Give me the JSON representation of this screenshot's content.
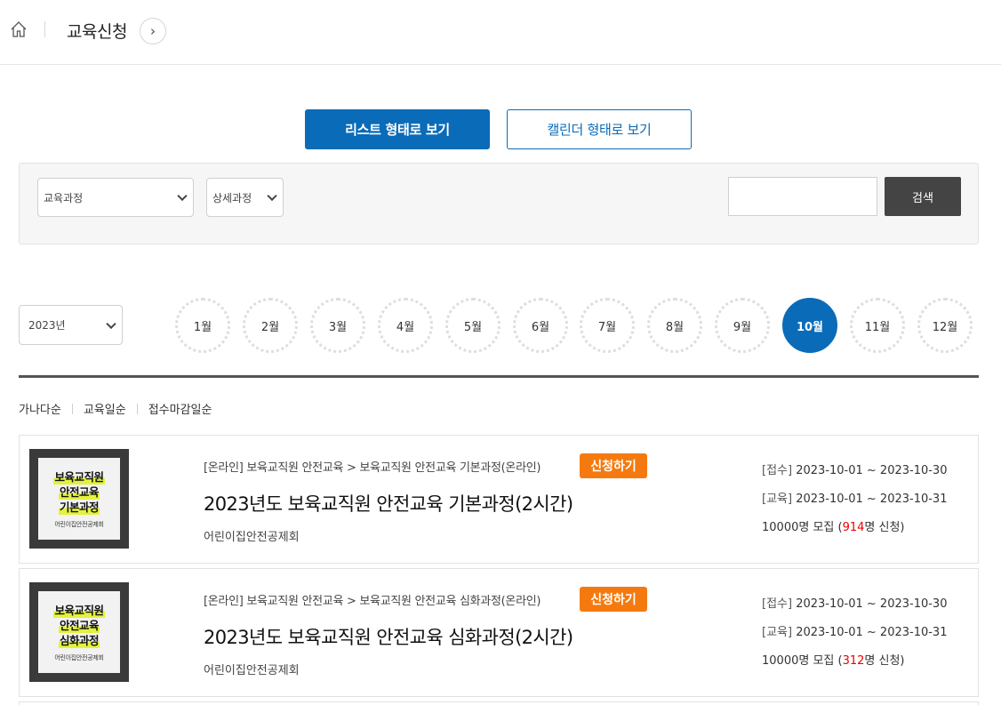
{
  "breadcrumb": {
    "title": "교육신청",
    "next_symbol": "›"
  },
  "view_toggle": {
    "list_label": "리스트 형태로 보기",
    "calendar_label": "캘린더 형태로 보기"
  },
  "filter": {
    "course_select": "교육과정",
    "detail_select": "상세과정",
    "search_value": "",
    "search_button": "검색"
  },
  "year_select": "2023년",
  "months": [
    "1월",
    "2월",
    "3월",
    "4월",
    "5월",
    "6월",
    "7월",
    "8월",
    "9월",
    "10월",
    "11월",
    "12월"
  ],
  "active_month": "10월",
  "sort": [
    "가나다순",
    "교육일순",
    "접수마감일순"
  ],
  "courses": [
    {
      "thumb_lines": [
        "보육교직원",
        "안전교육",
        "기본과정"
      ],
      "thumb_org": "어린이집안전공제회",
      "category": "[온라인] 보육교직원 안전교육 > 보육교직원 안전교육 기본과정(온라인)",
      "apply_label": "신청하기",
      "title": "2023년도 보육교직원 안전교육 기본과정(2시간)",
      "org": "어린이집안전공제회",
      "reg_label": "[접수]",
      "reg_period": "2023-10-01 ~ 2023-10-30",
      "edu_label": "[교육]",
      "edu_period": "2023-10-01 ~ 2023-10-31",
      "capacity_prefix": "10000명 모집 (",
      "applied": "914",
      "capacity_suffix": "명 신청)"
    },
    {
      "thumb_lines": [
        "보육교직원",
        "안전교육",
        "심화과정"
      ],
      "thumb_org": "어린이집안전공제회",
      "category": "[온라인] 보육교직원 안전교육 > 보육교직원 안전교육 심화과정(온라인)",
      "apply_label": "신청하기",
      "title": "2023년도 보육교직원 안전교육 심화과정(2시간)",
      "org": "어린이집안전공제회",
      "reg_label": "[접수]",
      "reg_period": "2023-10-01 ~ 2023-10-30",
      "edu_label": "[교육]",
      "edu_period": "2023-10-01 ~ 2023-10-31",
      "capacity_prefix": "10000명 모집 (",
      "applied": "312",
      "capacity_suffix": "명 신청)"
    }
  ],
  "colors": {
    "primary": "#0a6bb8",
    "apply": "#f47a10",
    "applied_count": "#e00000",
    "search_button": "#444444"
  }
}
